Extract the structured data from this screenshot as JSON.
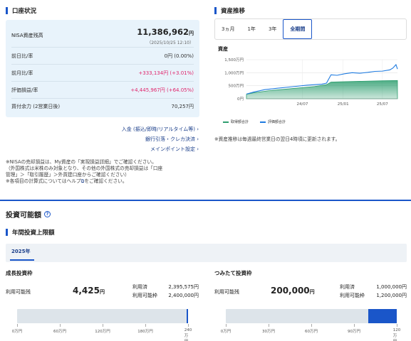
{
  "account": {
    "title": "口座状況",
    "nisa_label": "NISA資産残高",
    "nisa_value": "11,386,962",
    "nisa_unit": "円",
    "nisa_time": "（2025/10/25 12:10）",
    "rows": [
      {
        "label": "前日比/率",
        "value": "0円 (0.00%)"
      },
      {
        "label": "前月比/率",
        "value": "+333,134円 (+3.01%)"
      },
      {
        "label": "評価損益/率",
        "value": "+4,445,967円 (+64.05%)"
      },
      {
        "label": "買付余力 (2営業日後)",
        "value": "70,257円"
      }
    ],
    "links": [
      "入金 (振込/即時/リアルタイム等)",
      "銀行引落・クレカ決済",
      "メインポイント設定"
    ],
    "notes": [
      "※NISAの売却損益は、My資産の「実現損益詳細」でご確認ください。",
      "（外国株式は米株のみ対象となり、その他の外国株式の売却損益は「口座",
      "管理」＞「取引履歴」＞外貨建口座からご確認ください）",
      "※各項目の計算式についてはヘルプ",
      "をご確認ください。"
    ]
  },
  "trend": {
    "title": "資産推移",
    "tabs": [
      "3ヵ月",
      "1年",
      "3年",
      "全期間"
    ],
    "active_tab": "全期間",
    "chart_heading": "資産",
    "legend": [
      "取得額合計",
      "評価額合計"
    ],
    "note": "※資産推移は毎週最終営業日の翌日4時頃に更新されます。"
  },
  "chart_data": {
    "type": "area",
    "title": "資産",
    "x_ticks": [
      "24/07",
      "25/01",
      "25/07"
    ],
    "y_ticks": [
      "0円",
      "500万円",
      "1,000万円",
      "1,500万円"
    ],
    "ylim": [
      0,
      1500
    ],
    "y_unit": "万円",
    "series": [
      {
        "name": "取得額合計",
        "x": [
          0,
          0.05,
          0.15,
          0.3,
          0.45,
          0.53,
          0.56,
          0.62,
          0.75,
          0.9,
          1.0
        ],
        "values": [
          170,
          230,
          310,
          390,
          470,
          540,
          640,
          650,
          670,
          690,
          700
        ],
        "color": "#2e9e6f"
      },
      {
        "name": "評価額合計",
        "x": [
          0,
          0.05,
          0.12,
          0.2,
          0.3,
          0.4,
          0.5,
          0.53,
          0.56,
          0.6,
          0.65,
          0.7,
          0.75,
          0.8,
          0.85,
          0.9,
          0.95,
          0.97,
          0.99,
          1.0
        ],
        "values": [
          180,
          260,
          350,
          400,
          460,
          520,
          560,
          600,
          920,
          900,
          960,
          1000,
          980,
          1010,
          1050,
          1060,
          1110,
          1180,
          1310,
          1140
        ],
        "color": "#1f7be0"
      }
    ]
  },
  "invest": {
    "title": "投資可能額",
    "annual_label": "年間投資上限額",
    "year": "2025年",
    "growth": {
      "title": "成長投資枠",
      "avail_label": "利用可能残",
      "avail_value": "4,425",
      "unit": "円",
      "used_label": "利用済",
      "used_value": "2,395,575円",
      "limit_label": "利用可能枠",
      "limit_value": "2,400,000円",
      "fill_fraction": 0.998,
      "ticks": [
        "0万円",
        "60万円",
        "120万円",
        "180万円",
        "240万円"
      ]
    },
    "tsumitate": {
      "title": "つみたて投資枠",
      "avail_label": "利用可能残",
      "avail_value": "200,000",
      "unit": "円",
      "used_label": "利用済",
      "used_value": "1,000,000円",
      "limit_label": "利用可能枠",
      "limit_value": "1,200,000円",
      "fill_fraction": 0.833,
      "ticks": [
        "0万円",
        "30万円",
        "60万円",
        "90万円",
        "120万円"
      ]
    }
  }
}
